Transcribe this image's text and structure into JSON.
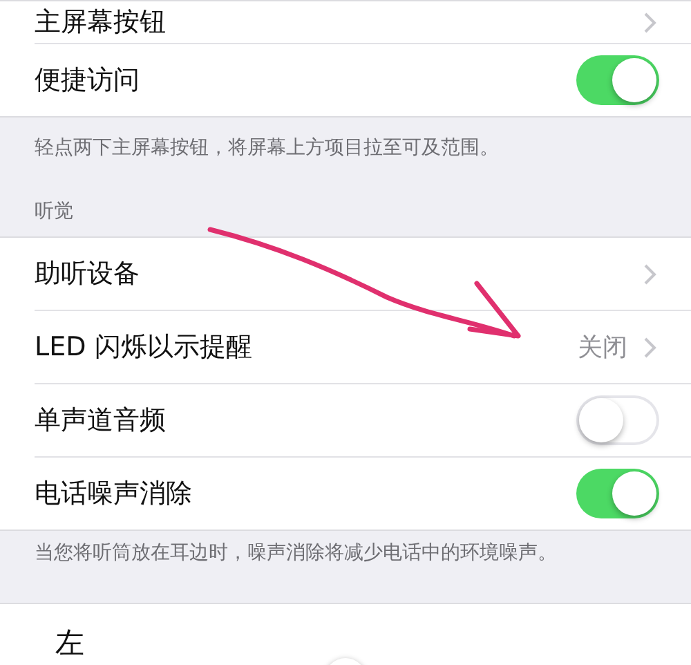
{
  "sections": [
    {
      "rows": [
        {
          "kind": "link",
          "label": "主屏幕按钮"
        },
        {
          "kind": "toggle",
          "label": "便捷访问",
          "on": true
        }
      ],
      "footer": "轻点两下主屏幕按钮，将屏幕上方项目拉至可及范围。"
    },
    {
      "header": "听觉",
      "rows": [
        {
          "kind": "link",
          "label": "助听设备"
        },
        {
          "kind": "link",
          "label": "LED 闪烁以示提醒",
          "value": "关闭"
        },
        {
          "kind": "toggle",
          "label": "单声道音频",
          "on": false
        },
        {
          "kind": "toggle",
          "label": "电话噪声消除",
          "on": true
        }
      ],
      "footer": "当您将听筒放在耳边时，噪声消除将减少电话中的环境噪声。"
    }
  ],
  "balance": {
    "label": "左",
    "level": 0.5
  }
}
